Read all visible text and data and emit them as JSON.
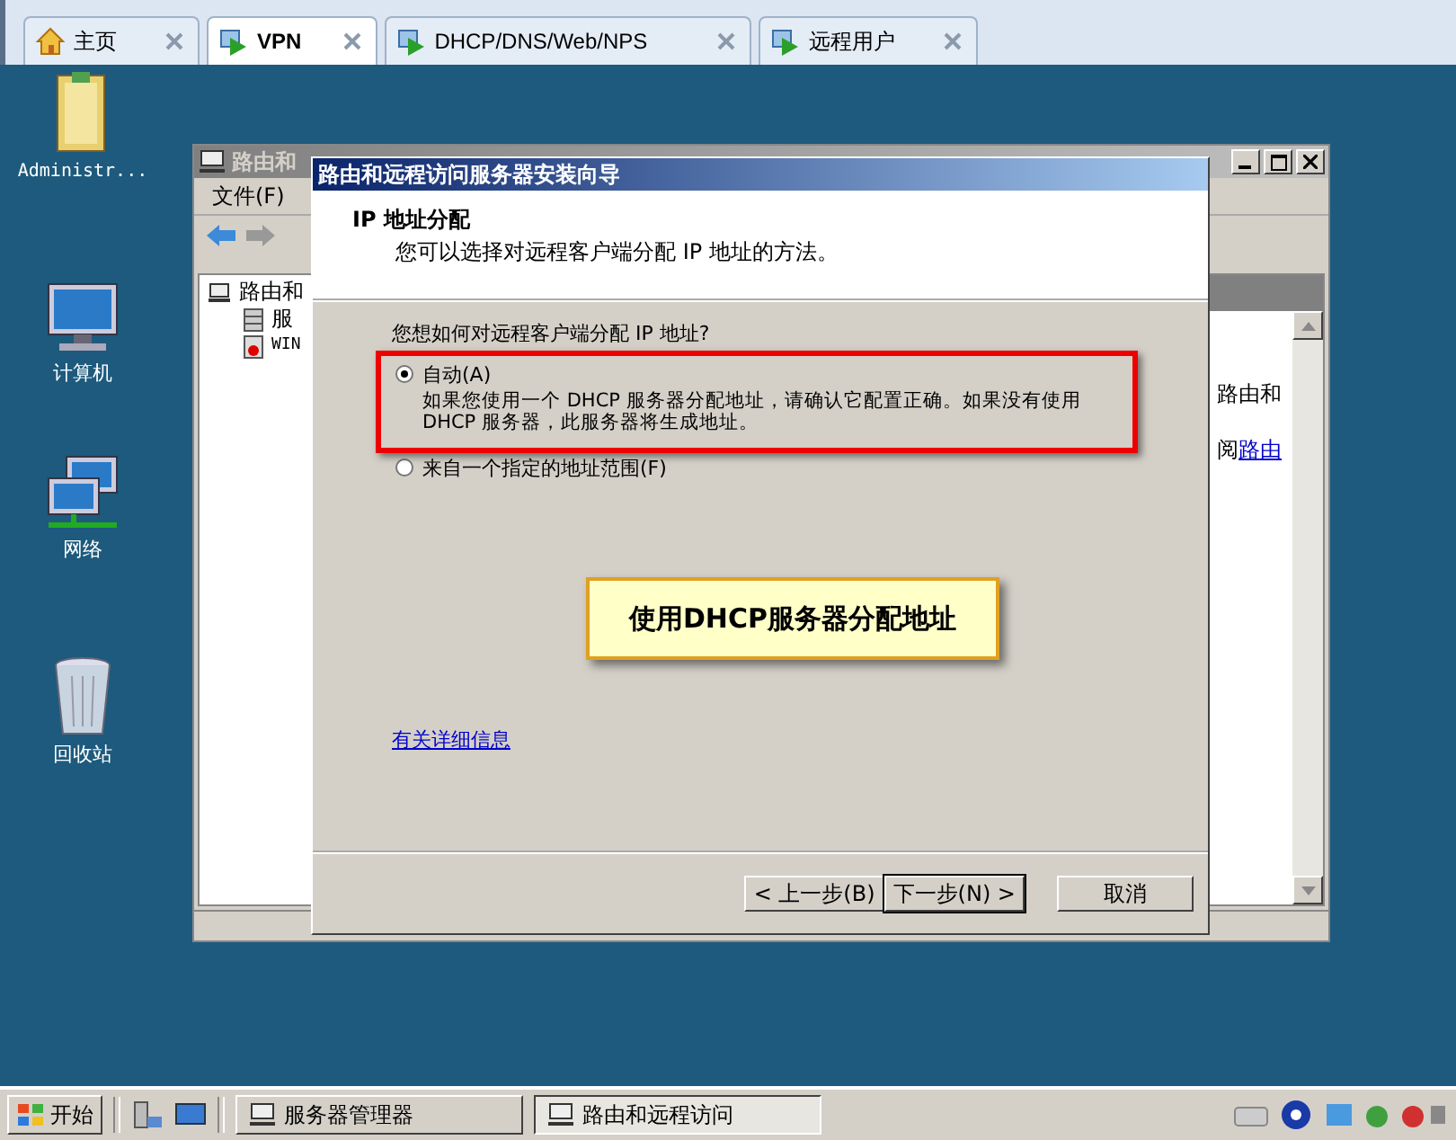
{
  "tabs": [
    {
      "label": "主页",
      "kind": "home",
      "selected": false
    },
    {
      "label": "VPN",
      "kind": "server",
      "selected": true
    },
    {
      "label": "DHCP/DNS/Web/NPS",
      "kind": "server",
      "selected": false
    },
    {
      "label": "远程用户",
      "kind": "server",
      "selected": false
    }
  ],
  "desktop_icons": [
    {
      "label": "Administr...",
      "kind": "folder"
    },
    {
      "label": "计算机",
      "kind": "computer"
    },
    {
      "label": "网络",
      "kind": "network"
    },
    {
      "label": "回收站",
      "kind": "bin"
    }
  ],
  "mmc_window": {
    "title": "路由和",
    "menu": [
      "文件(F)"
    ],
    "tree": [
      {
        "label": "路由和",
        "kind": "root",
        "children": [
          {
            "label": "服",
            "kind": "server"
          },
          {
            "label": "WIN",
            "kind": "host"
          }
        ]
      }
    ],
    "right_pane": {
      "text": "路由和",
      "link_prefix": "阅",
      "link": "路由"
    }
  },
  "wizard": {
    "title": "路由和远程访问服务器安装向导",
    "heading": "IP 地址分配",
    "subtitle": "您可以选择对远程客户端分配 IP 地址的方法。",
    "question": "您想如何对远程客户端分配 IP 地址?",
    "options": [
      {
        "label": "自动(A)",
        "selected": true,
        "description": "如果您使用一个 DHCP 服务器分配地址，请确认它配置正确。如果没有使用 DHCP 服务器，此服务器将生成地址。"
      },
      {
        "label": "来自一个指定的地址范围(F)",
        "selected": false
      }
    ],
    "link": "有关详细信息",
    "buttons": [
      {
        "label": "< 上一步(B)",
        "default": false
      },
      {
        "label": "下一步(N) >",
        "default": true
      },
      {
        "label": "取消",
        "default": false
      }
    ]
  },
  "annotations": [
    {
      "kind": "frame"
    },
    {
      "kind": "callout",
      "text": "使用DHCP服务器分配地址"
    }
  ],
  "taskbar": {
    "start": "开始",
    "tasks": [
      {
        "label": "服务器管理器",
        "selected": false
      },
      {
        "label": "路由和远程访问",
        "selected": true
      }
    ]
  }
}
